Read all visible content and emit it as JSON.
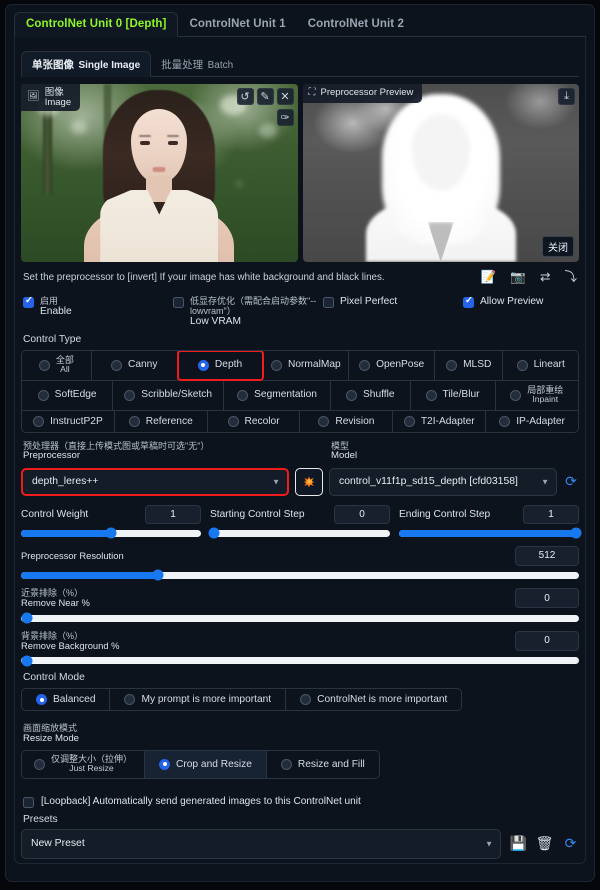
{
  "unit_tabs": [
    {
      "label": "ControlNet Unit 0 [Depth]",
      "active": true
    },
    {
      "label": "ControlNet Unit 1",
      "active": false
    },
    {
      "label": "ControlNet Unit 2",
      "active": false
    }
  ],
  "mode_tabs": [
    {
      "cn": "单张图像",
      "en": "Single Image",
      "active": true
    },
    {
      "cn": "批量处理",
      "en": "Batch",
      "active": false
    }
  ],
  "image_panel": {
    "badge_cn": "图像",
    "badge_en": "Image",
    "badge_icon": "image-icon",
    "buttons": [
      {
        "name": "undo-icon",
        "glyph": "↺"
      },
      {
        "name": "eraser-icon",
        "glyph": "✎"
      },
      {
        "name": "close-icon",
        "glyph": "✕"
      }
    ],
    "edit_button": {
      "name": "brush-icon",
      "glyph": "✑"
    }
  },
  "preview_panel": {
    "title": "Preprocessor Preview",
    "title_icon": "frame-icon",
    "download_icon": "download-icon",
    "download_glyph": "⤓",
    "close_label": "关闭"
  },
  "hint": {
    "text": "Set the preprocessor to [invert] If your image has white background and black lines.",
    "icons": [
      {
        "name": "memo-icon",
        "glyph": "📝"
      },
      {
        "name": "camera-icon",
        "glyph": "📷"
      },
      {
        "name": "swap-icon",
        "glyph": "⇄"
      },
      {
        "name": "send-icon",
        "glyph": "⤵"
      }
    ]
  },
  "checkboxes": [
    {
      "name": "enable",
      "cn": "启用",
      "en": "Enable",
      "checked": true
    },
    {
      "name": "low-vram",
      "cn": "低显存优化（需配合启动参数\"--lowvram\"）",
      "en": "Low VRAM",
      "checked": false
    },
    {
      "name": "pixel-perfect",
      "en": "Pixel Perfect",
      "checked": false
    },
    {
      "name": "allow-preview",
      "en": "Allow Preview",
      "checked": true
    }
  ],
  "control_type": {
    "label": "Control Type",
    "rows": [
      [
        {
          "cn": "全部",
          "en": "All",
          "selected": false
        },
        {
          "en": "Canny",
          "selected": false
        },
        {
          "en": "Depth",
          "selected": true,
          "highlight": true
        },
        {
          "en": "NormalMap",
          "selected": false
        },
        {
          "en": "OpenPose",
          "selected": false
        },
        {
          "en": "MLSD",
          "selected": false
        },
        {
          "en": "Lineart",
          "selected": false
        }
      ],
      [
        {
          "en": "SoftEdge",
          "selected": false
        },
        {
          "en": "Scribble/Sketch",
          "selected": false
        },
        {
          "en": "Segmentation",
          "selected": false
        },
        {
          "en": "Shuffle",
          "selected": false
        },
        {
          "en": "Tile/Blur",
          "selected": false
        },
        {
          "cn": "局部重绘",
          "en": "Inpaint",
          "selected": false
        }
      ],
      [
        {
          "en": "InstructP2P",
          "selected": false
        },
        {
          "en": "Reference",
          "selected": false
        },
        {
          "en": "Recolor",
          "selected": false
        },
        {
          "en": "Revision",
          "selected": false
        },
        {
          "en": "T2I-Adapter",
          "selected": false
        },
        {
          "en": "IP-Adapter",
          "selected": false
        }
      ]
    ]
  },
  "preprocessor": {
    "label_cn": "预处理器（直接上传模式图或草稿时可选\"无\"）",
    "label_en": "Preprocessor",
    "value": "depth_leres++"
  },
  "model": {
    "label_cn": "模型",
    "label_en": "Model",
    "value": "control_v11f1p_sd15_depth [cfd03158]",
    "refresh_icon": "refresh-icon",
    "refresh_glyph": "⟳"
  },
  "run_button": {
    "name": "run-preprocessor-button",
    "icon": "explosion-icon"
  },
  "sliders_triple": [
    {
      "name": "control-weight",
      "label": "Control Weight",
      "value": "1",
      "percent": 50
    },
    {
      "name": "starting-control-step",
      "label": "Starting Control Step",
      "value": "0",
      "percent": 0
    },
    {
      "name": "ending-control-step",
      "label": "Ending Control Step",
      "value": "1",
      "percent": 100
    }
  ],
  "sliders_full": [
    {
      "name": "preprocessor-resolution",
      "en": "Preprocessor Resolution",
      "cn": "",
      "value": "512",
      "percent": 25
    },
    {
      "name": "remove-near",
      "cn": "近景排除（%）",
      "en": "Remove Near %",
      "value": "0",
      "percent": 0
    },
    {
      "name": "remove-background",
      "cn": "背景排除（%）",
      "en": "Remove Background %",
      "value": "0",
      "percent": 0
    }
  ],
  "control_mode": {
    "label": "Control Mode",
    "options": [
      {
        "en": "Balanced",
        "selected": true
      },
      {
        "en": "My prompt is more important",
        "selected": false
      },
      {
        "en": "ControlNet is more important",
        "selected": false
      }
    ]
  },
  "resize_mode": {
    "label_cn": "画面缩放模式",
    "label_en": "Resize Mode",
    "options": [
      {
        "cn": "仅调整大小（拉伸）",
        "en": "Just Resize",
        "selected": false
      },
      {
        "en": "Crop and Resize",
        "selected": true
      },
      {
        "en": "Resize and Fill",
        "selected": false
      }
    ]
  },
  "loopback": {
    "label": "[Loopback] Automatically send generated images to this ControlNet unit",
    "checked": false
  },
  "presets": {
    "label": "Presets",
    "value": "New Preset",
    "buttons": [
      {
        "name": "save-preset-icon",
        "glyph": "💾"
      },
      {
        "name": "delete-preset-icon",
        "glyph": "🗑"
      },
      {
        "name": "refresh-preset-icon",
        "glyph": "⟳"
      }
    ]
  },
  "colors": {
    "accent_green": "#8ef727",
    "accent_blue": "#1878f0",
    "highlight_red": "#ee1c1c",
    "panel_bg": "#0d131c"
  }
}
